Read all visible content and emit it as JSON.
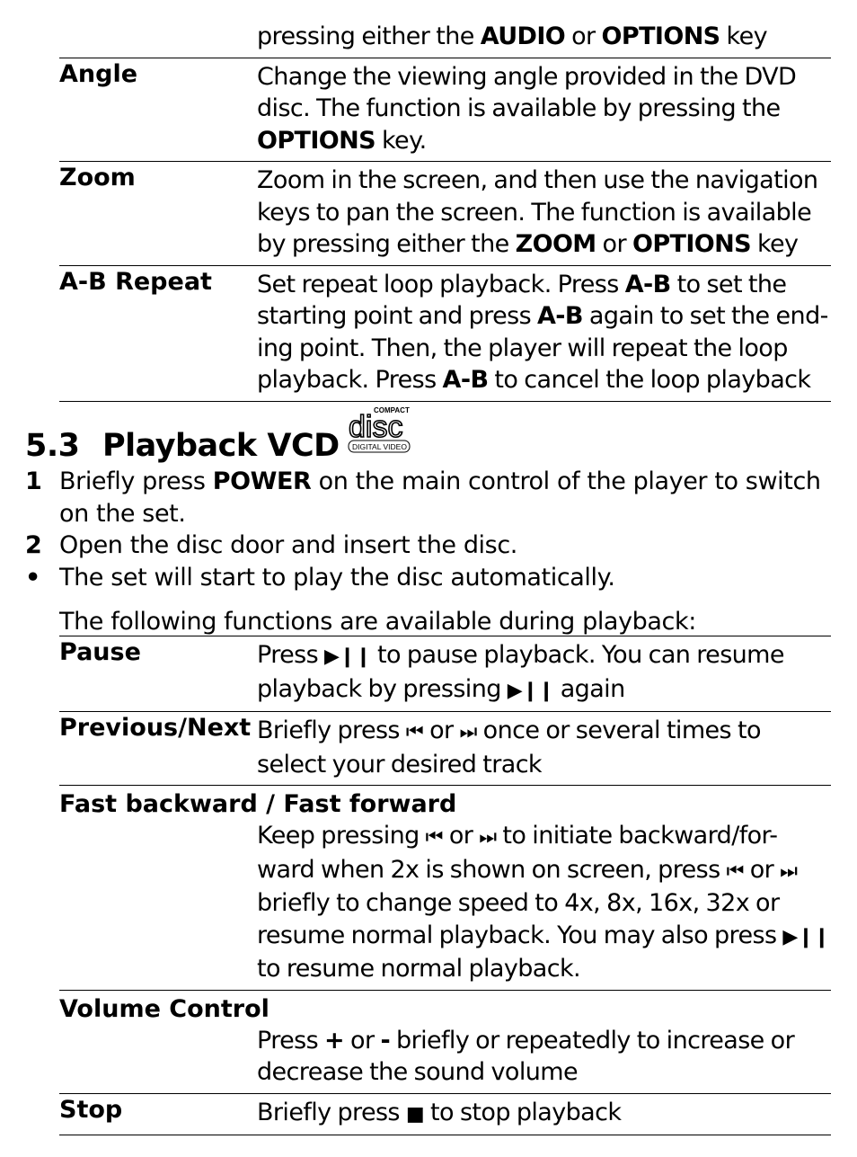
{
  "top_table": {
    "rows": [
      {
        "term": "",
        "desc_html": "pressing either the <b>AUDIO</b> or <b>OPTIONS</b> key"
      },
      {
        "term": "Angle",
        "desc_html": "Change the viewing angle provided in the DVD disc. The function is available by pressing the <b>OPTIONS</b> key."
      },
      {
        "term": "Zoom",
        "desc_html": "Zoom in the screen, and then use the navigation keys to pan the screen. The function is available by pressing either the <b>ZOOM</b> or <b>OPTIONS</b> key"
      },
      {
        "term": "A-B Repeat",
        "desc_html": "Set repeat loop playback. Press <b>A-B</b> to set the starting point and press <b>A-B</b> again to set the end-ing point. Then, the player will repeat the loop playback. Press <b>A-B</b> to cancel the loop playback"
      }
    ]
  },
  "section": {
    "number": "5.3",
    "title": "Playback VCD",
    "logo": {
      "icon": "compact-disc-digital-video-logo",
      "top": "COMPACT",
      "main": "disc",
      "bottom": "DIGITAL VIDEO"
    }
  },
  "steps": [
    {
      "marker": "1",
      "html": "Briefly press <b>POWER</b> on the main control of the player to switch on the set."
    },
    {
      "marker": "2",
      "html": "Open the disc door and insert the disc."
    },
    {
      "marker": "•",
      "html": "The set will start to play the disc automatically."
    }
  ],
  "intro": "The following functions are available during playback:",
  "functions_table": {
    "rows": [
      {
        "term": "Pause",
        "stacked": false,
        "desc_html": "Press <b class=\"sym\">▶❙❙</b> to pause playback. You can resume playback by pressing <b class=\"sym\">▶❙❙</b> again"
      },
      {
        "term": "Previous/Next",
        "stacked": false,
        "desc_html": "Briefly press <span class=\"sym\">⏮</span> or <span class=\"sym\">⏭</span> once or several times to select your desired track"
      },
      {
        "term": "Fast backward / Fast forward",
        "stacked": true,
        "desc_html": "Keep pressing <span class=\"sym\">⏮</span> or <span class=\"sym\">⏭</span> to initiate backward/for-ward when 2x is shown on screen, press <span class=\"sym\">⏮</span> or <span class=\"sym\">⏭</span> briefly to change speed to 4x, 8x, 16x, 32x or resume normal playback. You may also press <b class=\"sym\">▶❙❙</b> to resume normal playback."
      },
      {
        "term": "Volume Control",
        "stacked": true,
        "desc_html": "Press <b>+</b> or <b>-</b> briefly or repeatedly to increase or decrease the sound volume"
      },
      {
        "term": "Stop",
        "stacked": false,
        "desc_html": "Briefly press <span class=\"sym\">■</span> to stop playback"
      }
    ]
  }
}
